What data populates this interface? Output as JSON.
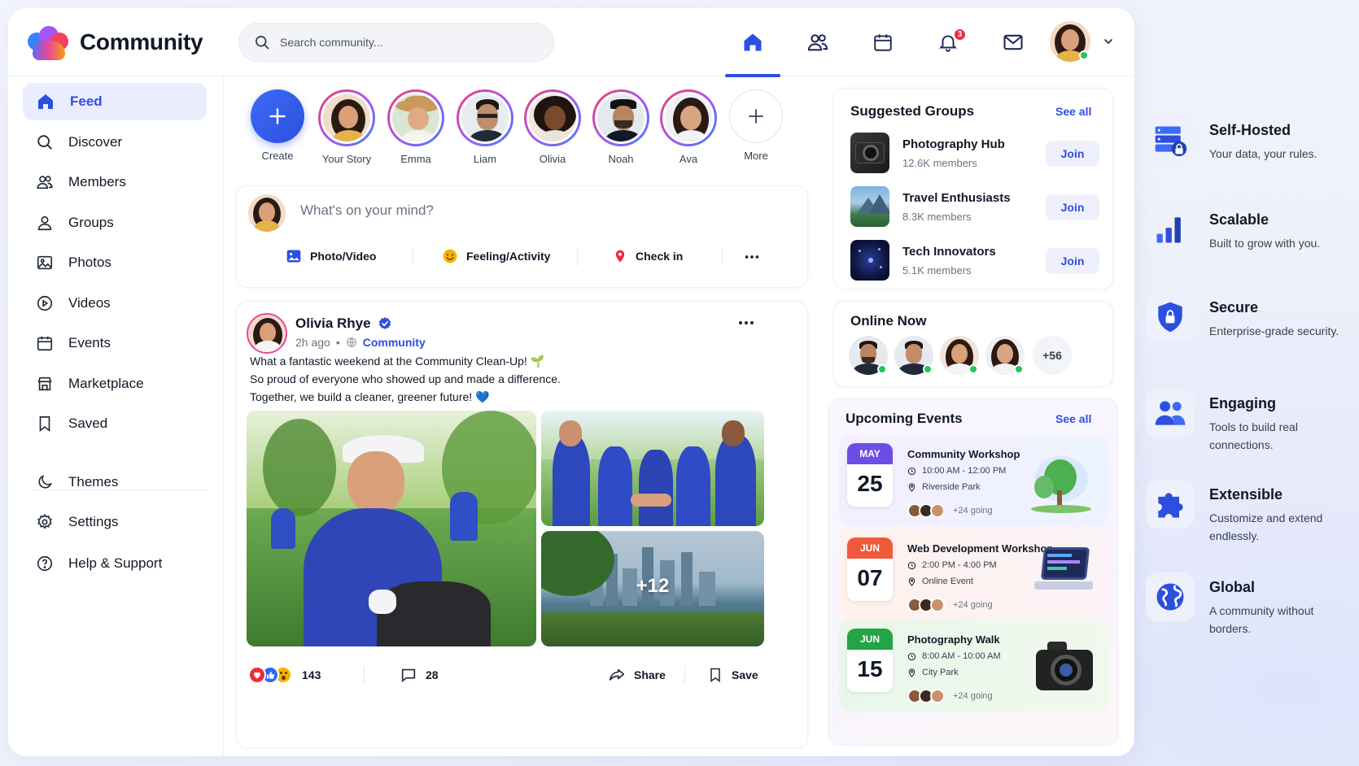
{
  "app": {
    "name": "Community"
  },
  "search": {
    "placeholder": "Search community..."
  },
  "nav": {
    "notifications_count": "3"
  },
  "sidebar": {
    "items": [
      {
        "label": "Feed"
      },
      {
        "label": "Discover"
      },
      {
        "label": "Members"
      },
      {
        "label": "Groups"
      },
      {
        "label": "Photos"
      },
      {
        "label": "Videos"
      },
      {
        "label": "Events"
      },
      {
        "label": "Marketplace"
      },
      {
        "label": "Saved"
      }
    ],
    "bottom": [
      {
        "label": "Themes"
      },
      {
        "label": "Settings"
      },
      {
        "label": "Help & Support"
      }
    ]
  },
  "stories": [
    {
      "name": "Create"
    },
    {
      "name": "Your Story"
    },
    {
      "name": "Emma"
    },
    {
      "name": "Liam"
    },
    {
      "name": "Olivia"
    },
    {
      "name": "Noah"
    },
    {
      "name": "Ava"
    },
    {
      "name": "More"
    }
  ],
  "composer": {
    "placeholder": "What's on your mind?",
    "photo_video": "Photo/Video",
    "feeling": "Feeling/Activity",
    "check_in": "Check in"
  },
  "post": {
    "author": "Olivia Rhye",
    "time": "2h ago",
    "dot": "•",
    "audience": "Community",
    "lines": [
      "What a fantastic weekend at the Community Clean-Up! 🌱",
      "So proud of everyone who showed up and made a difference.",
      "Together, we build a cleaner, greener future! 💙"
    ],
    "extra_photos": "+12",
    "reactions": "143",
    "comments": "28",
    "share": "Share",
    "save": "Save"
  },
  "groups": {
    "title": "Suggested Groups",
    "see_all": "See all",
    "join": "Join",
    "items": [
      {
        "name": "Photography Hub",
        "members": "12.6K members"
      },
      {
        "name": "Travel Enthusiasts",
        "members": "8.3K members"
      },
      {
        "name": "Tech Innovators",
        "members": "5.1K members"
      }
    ]
  },
  "online": {
    "title": "Online Now",
    "more": "+56"
  },
  "events": {
    "title": "Upcoming Events",
    "see_all": "See all",
    "items": [
      {
        "month": "MAY",
        "day": "25",
        "title": "Community Workshop",
        "time": "10:00 AM - 12:00 PM",
        "place": "Riverside Park",
        "going": "+24 going",
        "color": "#6d4de6"
      },
      {
        "month": "JUN",
        "day": "07",
        "title": "Web Development Workshop",
        "time": "2:00 PM - 4:00 PM",
        "place": "Online Event",
        "going": "+24 going",
        "color": "#f05a3c"
      },
      {
        "month": "JUN",
        "day": "15",
        "title": "Photography Walk",
        "time": "8:00 AM - 10:00 AM",
        "place": "City Park",
        "going": "+24 going",
        "color": "#22a447"
      }
    ]
  },
  "features": [
    {
      "title": "Self-Hosted",
      "desc": "Your data, your rules."
    },
    {
      "title": "Scalable",
      "desc": "Built to grow with you."
    },
    {
      "title": "Secure",
      "desc": "Enterprise-grade security."
    },
    {
      "title": "Engaging",
      "desc": "Tools to build real connections."
    },
    {
      "title": "Extensible",
      "desc": "Customize and extend endlessly."
    },
    {
      "title": "Global",
      "desc": "A community without borders."
    }
  ],
  "colors": {
    "accent": "#2d4fe0",
    "active_bg": "#eaedfd",
    "online": "#22c55e",
    "badge": "#ef2b3c"
  }
}
